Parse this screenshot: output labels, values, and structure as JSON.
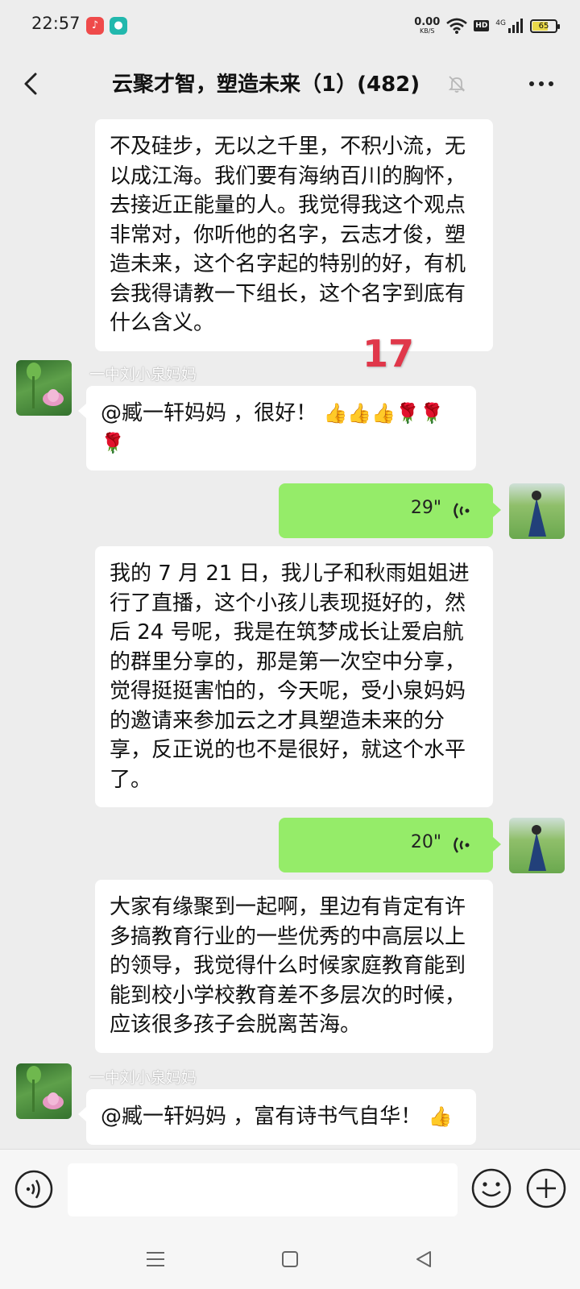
{
  "status_bar": {
    "time": "22:57",
    "speed_value": "0.00",
    "speed_unit": "KB/S",
    "hd": "HD",
    "network": "4G",
    "battery": "65"
  },
  "header": {
    "title": "云聚才智，塑造未来（1）(482)",
    "back_icon": "chevron-left-icon",
    "mute_icon": "bell-off-icon",
    "more_icon": "more-dots-icon"
  },
  "messages": [
    {
      "type": "text",
      "text": "不及硅步，无以之千里，不积小流，无以成江海。我们要有海纳百川的胸怀，去接近正能量的人。我觉得我这个观点非常对，你听他的名字，云志才俊，塑造未来，这个名字起的特别的好，有机会我得请教一下组长，这个名字到底有什么含义。"
    },
    {
      "type": "incoming",
      "sender": "一中刘小泉妈妈",
      "text": "@臧一轩妈妈 ，很好！",
      "emojis": [
        "👍",
        "👍",
        "👍",
        "🌹",
        "🌹",
        "🌹"
      ]
    },
    {
      "type": "voice",
      "duration": "29\""
    },
    {
      "type": "text",
      "text": "我的 7 月 21 日，我儿子和秋雨姐姐进行了直播，这个小孩儿表现挺好的，然后 24 号呢，我是在筑梦成长让爱启航的群里分享的，那是第一次空中分享，觉得挺挺害怕的，今天呢，受小泉妈妈的邀请来参加云之才具塑造未来的分享，反正说的也不是很好，就这个水平了。"
    },
    {
      "type": "voice",
      "duration": "20\""
    },
    {
      "type": "text",
      "text": "大家有缘聚到一起啊，里边有肯定有许多搞教育行业的一些优秀的中高层以上的领导，我觉得什么时候家庭教育能到能到校小学校教育差不多层次的时候，应该很多孩子会脱离苦海。"
    },
    {
      "type": "incoming",
      "sender": "一中刘小泉妈妈",
      "text": "@臧一轩妈妈 ，富有诗书气自华！",
      "emojis": [
        "👍"
      ]
    }
  ],
  "overlay_number": "17",
  "input_bar": {
    "voice_icon": "voice-input-icon",
    "emoji_icon": "smiley-icon",
    "plus_icon": "plus-icon"
  },
  "nav_bar": {
    "icons": [
      "menu-icon",
      "home-square-icon",
      "back-triangle-icon"
    ]
  },
  "colors": {
    "background": "#ededed",
    "voice_bubble": "#95ec69",
    "accent_red": "#e0374a"
  }
}
